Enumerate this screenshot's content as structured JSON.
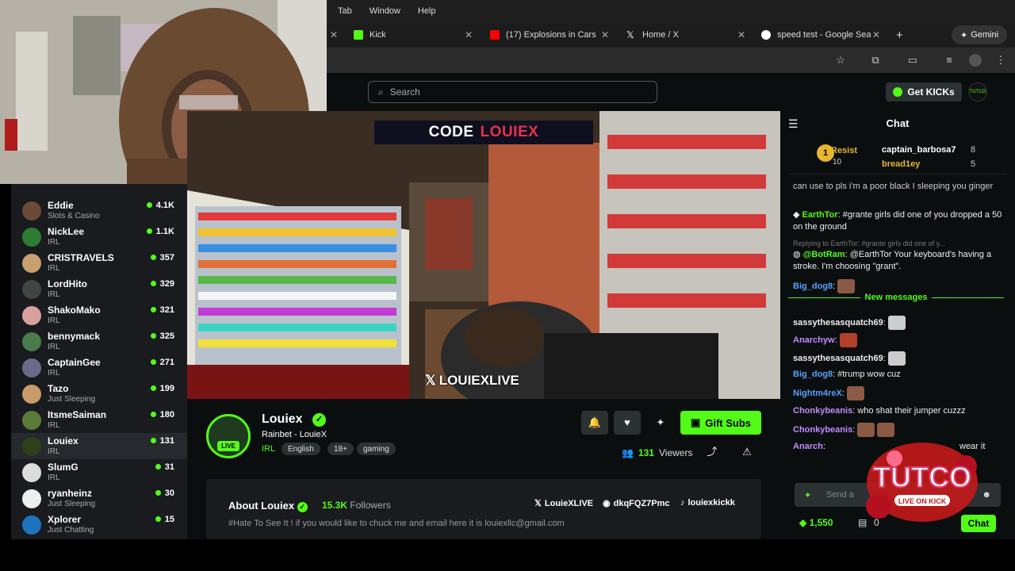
{
  "menubar": {
    "items": [
      "Tab",
      "Window",
      "Help"
    ]
  },
  "tabs": [
    {
      "label": "Kick",
      "color": "#53fc18"
    },
    {
      "label": "(17) Explosions in Cars",
      "color": "#ff0000"
    },
    {
      "label": "Home / X",
      "color": "#ffffff"
    },
    {
      "label": "speed test - Google Search",
      "color": "#4285f4"
    }
  ],
  "gemini": "Gemini",
  "kick": {
    "search_placeholder": "Search",
    "get_kicks": "Get KICKs",
    "user_avatar_text": "TUTCO"
  },
  "sidebar": {
    "channels": [
      {
        "name": "Eddie",
        "category": "Slots & Casino",
        "viewers": "4.1K",
        "color": "#6b4a3a"
      },
      {
        "name": "NickLee",
        "category": "IRL",
        "viewers": "1.1K",
        "color": "#2e7d32"
      },
      {
        "name": "CRISTRAVELS",
        "category": "IRL",
        "viewers": "357",
        "color": "#c8a070"
      },
      {
        "name": "LordHito",
        "category": "IRL",
        "viewers": "329",
        "color": "#444"
      },
      {
        "name": "ShakoMako",
        "category": "IRL",
        "viewers": "321",
        "color": "#d9a0a0"
      },
      {
        "name": "bennymack",
        "category": "IRL",
        "viewers": "325",
        "color": "#4a7b4a"
      },
      {
        "name": "CaptainGee",
        "category": "IRL",
        "viewers": "271",
        "color": "#6a6a8a"
      },
      {
        "name": "Tazo",
        "category": "Just Sleeping",
        "viewers": "199",
        "color": "#c99a6a"
      },
      {
        "name": "ItsmeSaiman",
        "category": "IRL",
        "viewers": "180",
        "color": "#5b7a3a"
      },
      {
        "name": "Louiex",
        "category": "IRL",
        "viewers": "131",
        "color": "#2f3f1a"
      },
      {
        "name": "SlumG",
        "category": "IRL",
        "viewers": "31",
        "color": "#dddddd"
      },
      {
        "name": "ryanheinz",
        "category": "Just Sleeping",
        "viewers": "30",
        "color": "#eeeeee"
      },
      {
        "name": "Xplorer",
        "category": "Just Chatting",
        "viewers": "15",
        "color": "#1e73be"
      }
    ]
  },
  "stream": {
    "code_word": "CODE",
    "code_name": "LOUIEX",
    "watermark": "LOUIEXLIVE",
    "name": "Louiex",
    "live_badge": "LIVE",
    "title": "Rainbet - LouieX",
    "category": "IRL",
    "tags": [
      "English",
      "18+",
      "gaming"
    ],
    "viewers_count": "131",
    "viewers_label": "Viewers",
    "gift_subs": "Gift Subs",
    "about_title": "About Louiex",
    "followers_count": "15.3K",
    "followers_label": "Followers",
    "about_desc": "#Hate To See It ! if you would like to chuck me and email here it is louiexllc@gmail.com",
    "social_x": "LouieXLIVE",
    "social_discord": "dkqFQZ7Pmc",
    "social_tiktok": "louiexkickk"
  },
  "chat": {
    "title": "Chat",
    "pinned": {
      "rank": "1",
      "name": "Resist",
      "count": "10",
      "top2": "captain_barbosa7",
      "top2_count": "8",
      "top3": "bread1ey",
      "top3_count": "5"
    },
    "messages": [
      {
        "user": "",
        "text": "can use to pls i'm a poor black I sleeping you ginger",
        "color": "#eee"
      },
      {
        "user": "EarthTor",
        "text": "#grante girls did one of you dropped a 50 on the ground",
        "color": "#53fc18"
      },
      {
        "user": "",
        "text": "Replying to EarthTor: #grante girls did one of y...",
        "color": "#888"
      },
      {
        "user": "@BotRam",
        "text": "@EarthTor Your keyboard's having a stroke. I'm choosing \"grant\".",
        "color": "#53fc18"
      },
      {
        "user": "Big_dog8",
        "text": "",
        "color": "#5aa0ff"
      }
    ],
    "new_messages": "New messages",
    "messages2": [
      {
        "user": "sassythesasquatch69",
        "text": "",
        "color": "#fff"
      },
      {
        "user": "Anarchyw",
        "text": "",
        "color": "#c08cff"
      },
      {
        "user": "sassythesasquatch69",
        "text": "",
        "color": "#fff"
      },
      {
        "user": "Big_dog8",
        "text": "#trump wow cuz",
        "color": "#5aa0ff"
      },
      {
        "user": "Nightm4reX",
        "text": "",
        "color": "#5aa0ff"
      },
      {
        "user": "Chonkybeanis",
        "text": "who shat their jumper cuzzz",
        "color": "#c08cff"
      },
      {
        "user": "Chonkybeanis",
        "text": "",
        "color": "#c08cff"
      },
      {
        "user": "Anarch",
        "text": "wear it",
        "color": "#c08cff"
      }
    ],
    "input_placeholder": "Send a",
    "points": "1,550",
    "bottom_count": "0",
    "send_btn": "Chat"
  },
  "overlay": {
    "brand": "TUTCO",
    "sub": "LIVE ON KICK"
  }
}
